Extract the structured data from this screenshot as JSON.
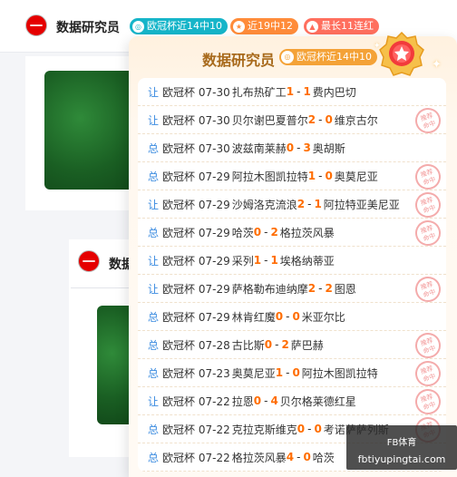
{
  "author": {
    "name": "数据研究员",
    "tags": [
      {
        "label": "欧冠杯近14中10",
        "icon": "target-icon",
        "color": "#16b5c9"
      },
      {
        "label": "近19中12",
        "icon": "star-icon",
        "color": "#ff8c3a"
      },
      {
        "label": "最长11连红",
        "icon": "flame-icon",
        "color": "#ff6f5e"
      }
    ]
  },
  "second_author": {
    "name": "数据"
  },
  "panel": {
    "title": "数据研究员",
    "badge": "欧冠杯近14中10",
    "matches": [
      {
        "type": "让",
        "league": "欧冠杯",
        "date": "07-30",
        "home": "扎布热矿工",
        "hs": "1",
        "as": "1",
        "away": "费内巴切",
        "stamp": false
      },
      {
        "type": "让",
        "league": "欧冠杯",
        "date": "07-30",
        "home": "贝尔谢巴夏普尔",
        "hs": "2",
        "as": "0",
        "away": "维京古尔",
        "stamp": true
      },
      {
        "type": "总",
        "league": "欧冠杯",
        "date": "07-30",
        "home": "波兹南莱赫",
        "hs": "0",
        "as": "3",
        "away": "奥胡斯",
        "stamp": false
      },
      {
        "type": "总",
        "league": "欧冠杯",
        "date": "07-29",
        "home": "阿拉木图凯拉特",
        "hs": "1",
        "as": "0",
        "away": "奥莫尼亚",
        "stamp": true
      },
      {
        "type": "让",
        "league": "欧冠杯",
        "date": "07-29",
        "home": "沙姆洛克流浪",
        "hs": "2",
        "as": "1",
        "away": "阿拉特亚美尼亚",
        "stamp": true
      },
      {
        "type": "总",
        "league": "欧冠杯",
        "date": "07-29",
        "home": "哈茨",
        "hs": "0",
        "as": "2",
        "away": "格拉茨风暴",
        "stamp": true
      },
      {
        "type": "让",
        "league": "欧冠杯",
        "date": "07-29",
        "home": "采列",
        "hs": "1",
        "as": "1",
        "away": "埃格纳蒂亚",
        "stamp": false
      },
      {
        "type": "让",
        "league": "欧冠杯",
        "date": "07-29",
        "home": "萨格勒布迪纳摩",
        "hs": "2",
        "as": "2",
        "away": "图恩",
        "stamp": true
      },
      {
        "type": "总",
        "league": "欧冠杯",
        "date": "07-29",
        "home": "林肯红魔",
        "hs": "0",
        "as": "0",
        "away": "米亚尔比",
        "stamp": false
      },
      {
        "type": "总",
        "league": "欧冠杯",
        "date": "07-28",
        "home": "古比斯",
        "hs": "0",
        "as": "2",
        "away": "萨巴赫",
        "stamp": true
      },
      {
        "type": "总",
        "league": "欧冠杯",
        "date": "07-23",
        "home": "奥莫尼亚",
        "hs": "1",
        "as": "0",
        "away": "阿拉木图凯拉特",
        "stamp": true
      },
      {
        "type": "让",
        "league": "欧冠杯",
        "date": "07-22",
        "home": "拉恩",
        "hs": "0",
        "as": "4",
        "away": "贝尔格莱德红星",
        "stamp": true
      },
      {
        "type": "总",
        "league": "欧冠杯",
        "date": "07-22",
        "home": "克拉克斯维克",
        "hs": "0",
        "as": "0",
        "away": "考诺萨萨列斯",
        "stamp": true
      },
      {
        "type": "总",
        "league": "欧冠杯",
        "date": "07-22",
        "home": "格拉茨风暴",
        "hs": "4",
        "as": "0",
        "away": "哈茨",
        "stamp": false
      }
    ],
    "stamp_text": [
      "推荐",
      "命中"
    ]
  },
  "watermark": {
    "line1": "FB体育",
    "line2": "fbtiyupingtai.com"
  },
  "colors": {
    "score": "#ff6d00",
    "type": "#3a8be0",
    "panel_title": "#a86a1c"
  }
}
